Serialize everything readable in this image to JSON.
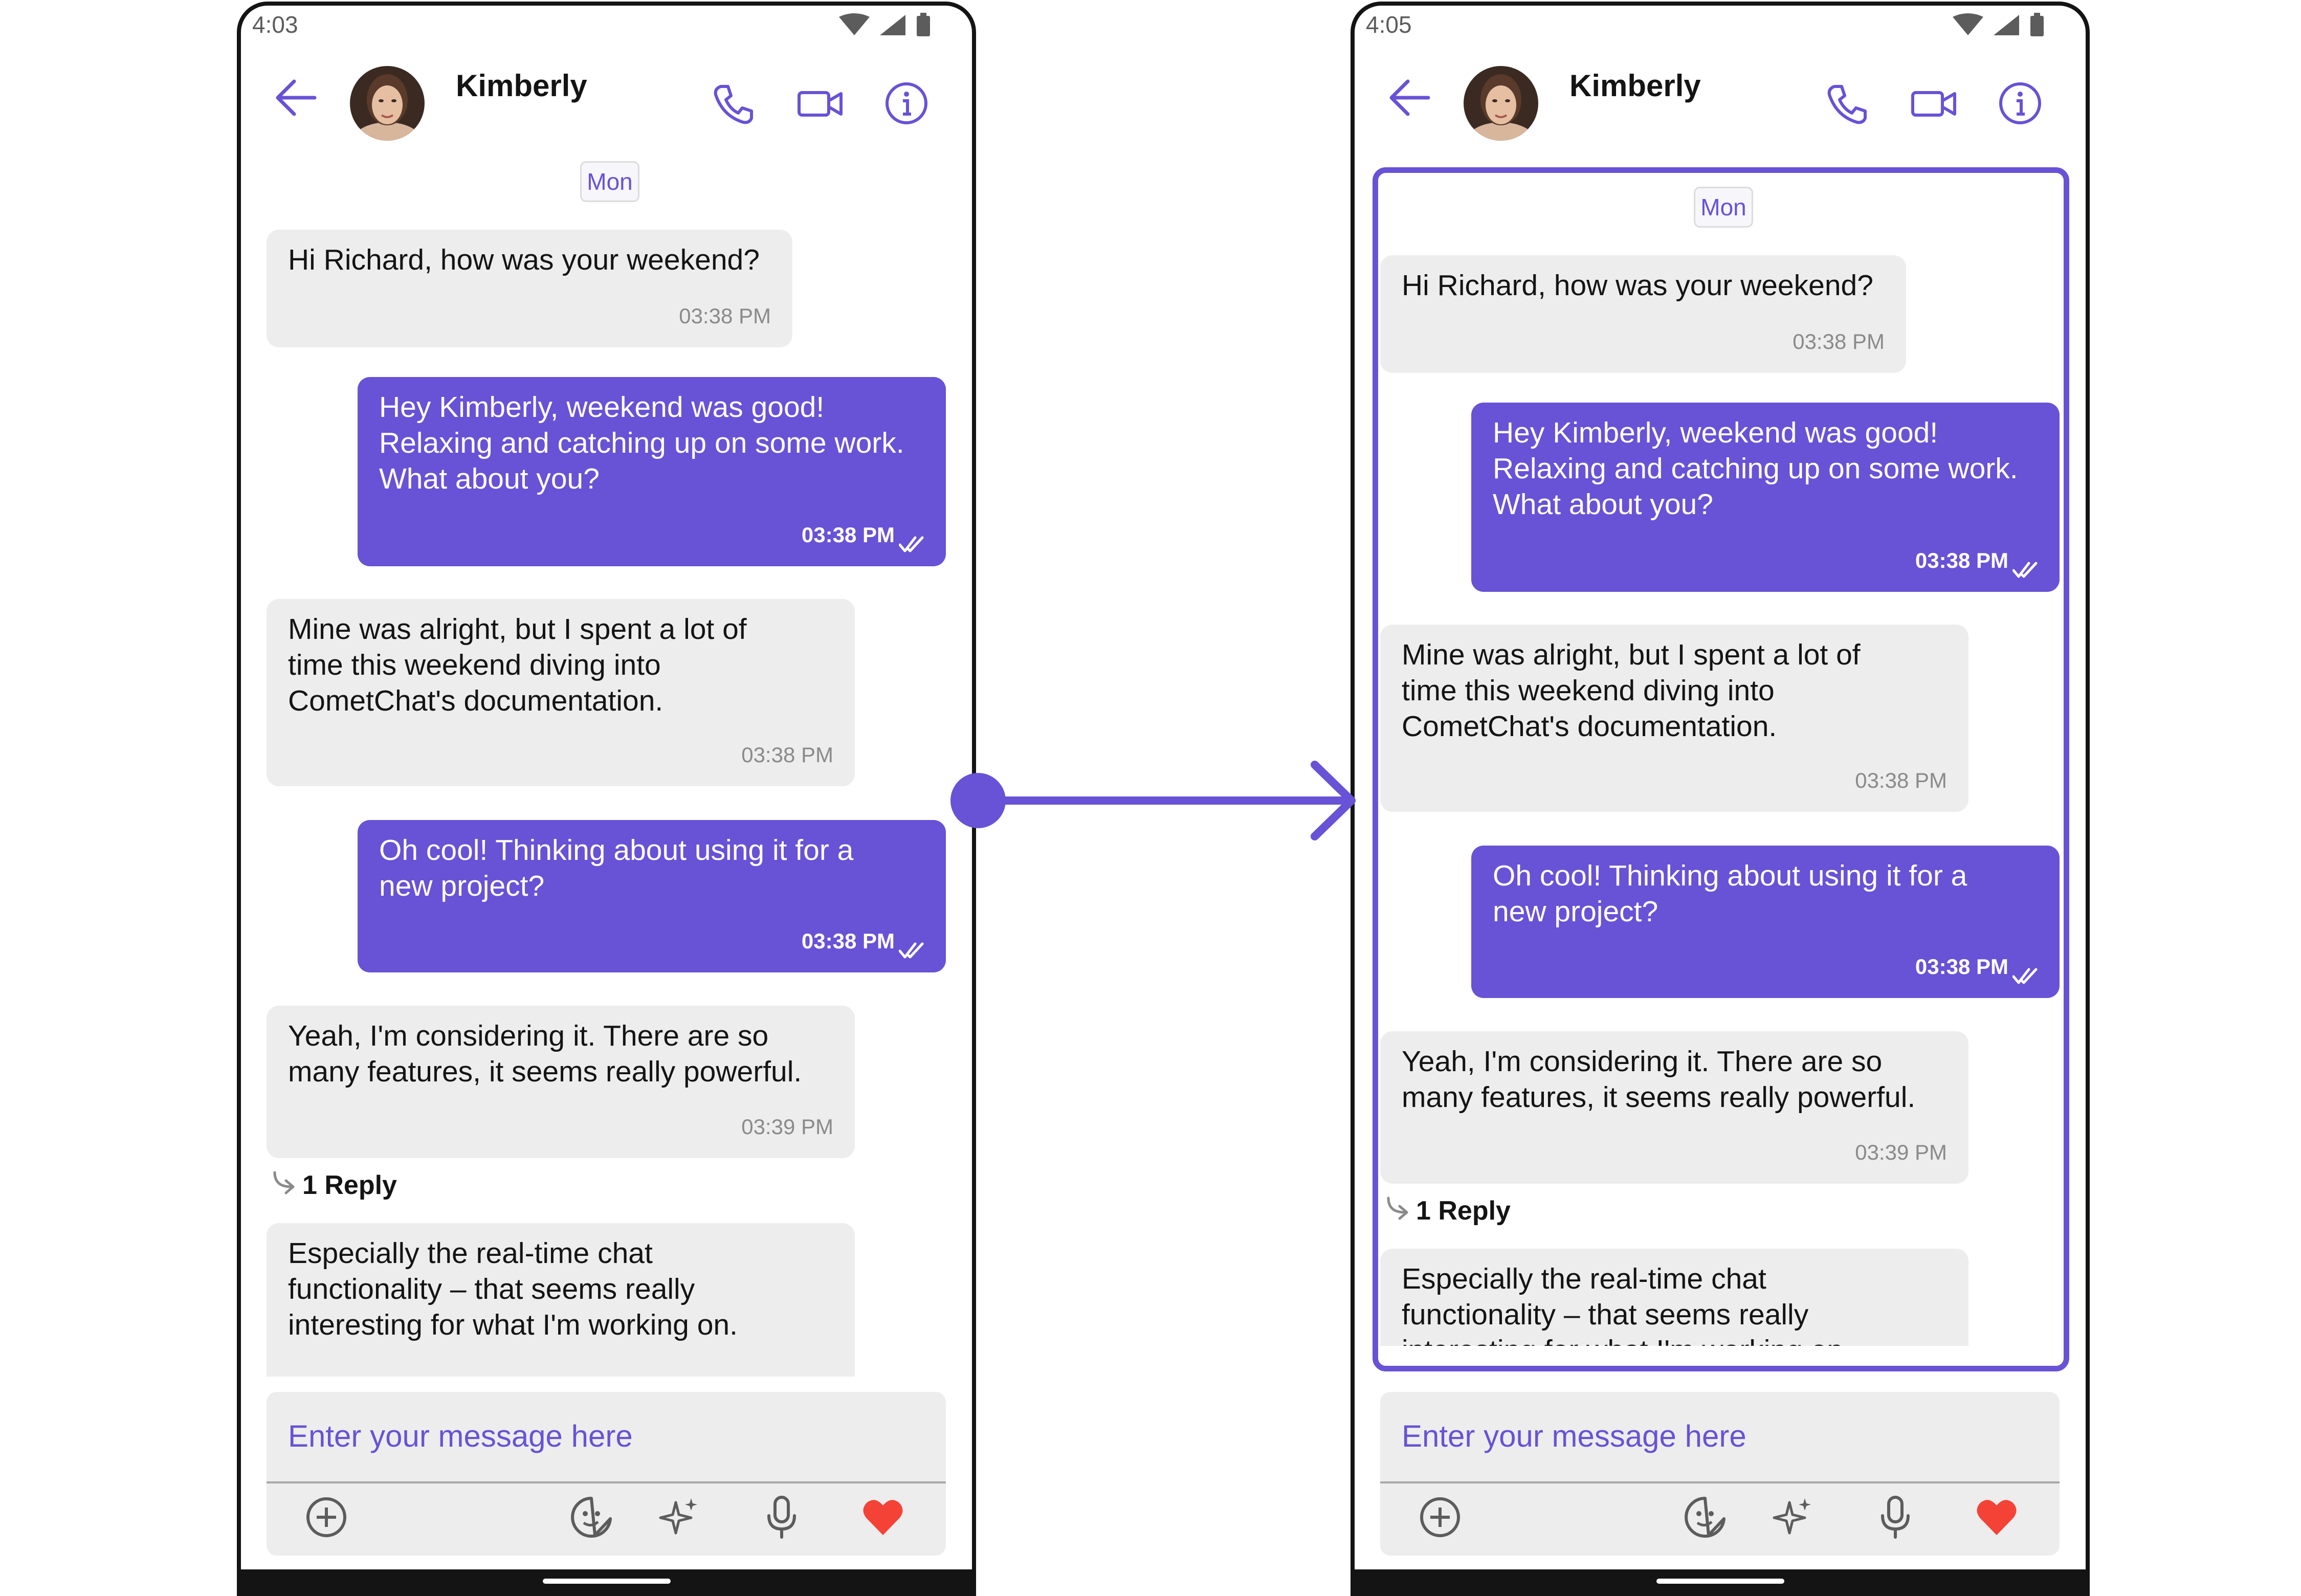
{
  "colors": {
    "accent": "#6852d6",
    "incoming_bubble": "#ededed",
    "heart": "#f44336"
  },
  "icons": {
    "status": [
      "wifi-icon",
      "cellular-signal-icon",
      "battery-icon"
    ],
    "header": [
      "back-arrow-icon",
      "voice-call-icon",
      "video-call-icon",
      "info-icon"
    ],
    "composer": [
      "add-attachment-icon",
      "sticker-icon",
      "ai-sparkle-icon",
      "microphone-icon",
      "heart-icon"
    ],
    "message": [
      "double-check-icon",
      "reply-arrow-icon"
    ]
  },
  "left": {
    "status_time": "4:03",
    "header": {
      "name": "Kimberly"
    },
    "date_label": "Mon",
    "messages": [
      {
        "text": "Hi Richard, how was your weekend?",
        "time": "03:38 PM"
      },
      {
        "text": "Hey Kimberly, weekend was good!\nRelaxing and catching up on some work.\nWhat about you?",
        "time": "03:38 PM"
      },
      {
        "text": "Mine was alright, but I spent a lot of\ntime this weekend diving into\nCometChat's documentation.",
        "time": "03:38 PM"
      },
      {
        "text": "Oh cool! Thinking about using it for a\nnew project?",
        "time": "03:38 PM"
      },
      {
        "text": "Yeah, I'm considering it.  There are so\nmany features, it seems really powerful.",
        "time": "03:39 PM"
      },
      {
        "text": "Especially the real-time chat\nfunctionality – that seems really\ninteresting for what I'm working on."
      }
    ],
    "reply_label": "1 Reply",
    "composer_placeholder": "Enter your message here"
  },
  "right": {
    "status_time": "4:05",
    "header": {
      "name": "Kimberly"
    },
    "date_label": "Mon",
    "messages": [
      {
        "text": "Hi Richard, how was your weekend?",
        "time": "03:38 PM"
      },
      {
        "text": "Hey Kimberly, weekend was good!\nRelaxing and catching up on some work.\nWhat about you?",
        "time": "03:38 PM"
      },
      {
        "text": "Mine was alright, but I spent a lot of\ntime this weekend diving into\nCometChat's documentation.",
        "time": "03:38 PM"
      },
      {
        "text": "Oh cool! Thinking about using it for a\nnew project?",
        "time": "03:38 PM"
      },
      {
        "text": "Yeah, I'm considering it.  There are so\nmany features, it seems really powerful.",
        "time": "03:39 PM"
      },
      {
        "text": "Especially the real-time chat\nfunctionality – that seems really\ninteresting for what I'm working on."
      }
    ],
    "reply_label": "1 Reply",
    "composer_placeholder": "Enter your message here"
  }
}
